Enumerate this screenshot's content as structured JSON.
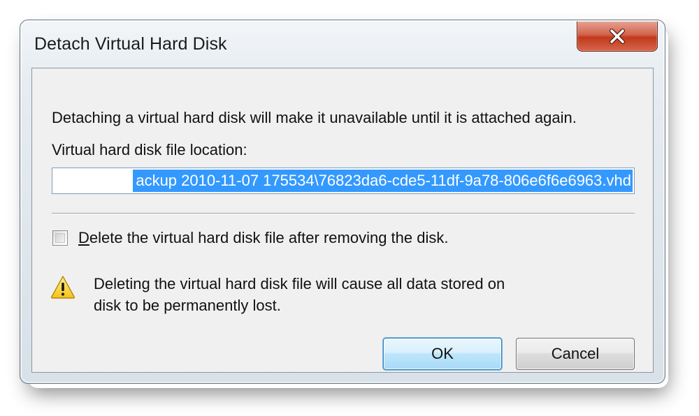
{
  "window": {
    "title": "Detach Virtual Hard Disk"
  },
  "dialog": {
    "message": "Detaching a virtual hard disk will make it unavailable until it is attached again.",
    "file_location_label": "Virtual hard disk file location:",
    "file_location_value": "ackup 2010-11-07 175534\\76823da6-cde5-11df-9a78-806e6f6e6963.vhd",
    "delete_checkbox": {
      "label": "Delete the virtual hard disk file after removing the disk.",
      "checked": false
    },
    "warning": {
      "icon": "warning-icon",
      "line1": "Deleting the virtual hard disk file will cause all data stored on",
      "line2": "disk to be permanently lost."
    }
  },
  "buttons": {
    "ok_label": "OK",
    "cancel_label": "Cancel"
  },
  "colors": {
    "selection": "#3399ff",
    "close_button": "#c2391c",
    "default_button_border": "#3c7fb1"
  }
}
